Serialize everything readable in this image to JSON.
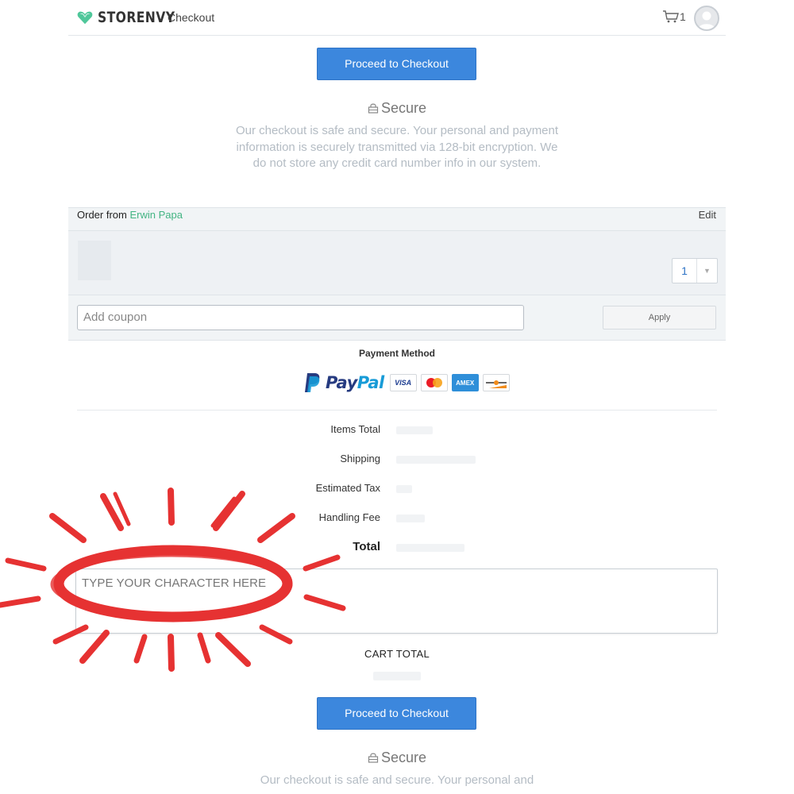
{
  "header": {
    "brand": "STORENVY",
    "section": "Checkout",
    "cart_count": "1"
  },
  "checkout": {
    "proceed_label": "Proceed to Checkout",
    "secure_title": "Secure",
    "secure_text": "Our checkout is safe and secure. Your personal and payment information is securely transmitted via 128-bit encryption. We do not store any credit card number info in our system.",
    "secure_text_partial": "Our checkout is safe and secure. Your personal and"
  },
  "order": {
    "from_label": "Order from",
    "shop_name": "Erwin Papa",
    "edit_label": "Edit",
    "quantity": "1"
  },
  "coupon": {
    "placeholder": "Add coupon",
    "apply_label": "Apply"
  },
  "payment": {
    "title": "Payment Method",
    "paypal_pay": "Pay",
    "paypal_pal": "Pal",
    "cards": [
      "VISA",
      "AMEX"
    ]
  },
  "totals": {
    "items_total": "Items Total",
    "shipping": "Shipping",
    "estimated_tax": "Estimated Tax",
    "handling_fee": "Handling Fee",
    "total": "Total"
  },
  "note": {
    "placeholder": "TYPE YOUR CHARACTER HERE"
  },
  "cart_total_label": "CART TOTAL",
  "colors": {
    "primary_button": "#3c87dd",
    "shop_link": "#43b483",
    "annotation_red": "#e63232",
    "brand_heart": "#4fc79a"
  }
}
